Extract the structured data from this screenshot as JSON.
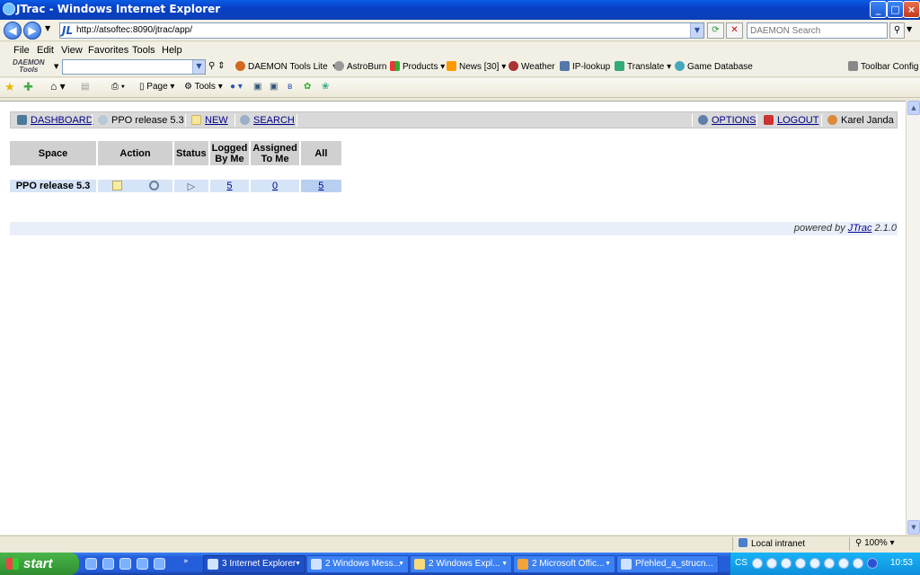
{
  "window": {
    "title": "JTrac - Windows Internet Explorer"
  },
  "address": {
    "url": "http://atsoftec:8090/jtrac/app/",
    "search_placeholder": "DAEMON Search"
  },
  "menu": [
    "File",
    "Edit",
    "View",
    "Favorites",
    "Tools",
    "Help"
  ],
  "daemon_toolbar": {
    "logo_line1": "DAEMON",
    "logo_line2": "Tools",
    "items": [
      "DAEMON Tools Lite",
      "AstroBurn",
      "Products",
      "News [30]",
      "Weather",
      "IP-lookup",
      "Translate",
      "Game Database",
      "Toolbar Config"
    ]
  },
  "command_bar": {
    "page": "Page",
    "tools": "Tools"
  },
  "jtrac": {
    "header": {
      "dashboard": "DASHBOARD",
      "space": "PPO release 5.3",
      "new": "NEW",
      "search": "SEARCH",
      "options": "OPTIONS",
      "logout": "LOGOUT",
      "user": "Karel Janda"
    },
    "table": {
      "headers": {
        "space": "Space",
        "action": "Action",
        "status": "Status",
        "logged_1": "Logged",
        "logged_2": "By Me",
        "assigned_1": "Assigned",
        "assigned_2": "To Me",
        "all": "All"
      },
      "row": {
        "space": "PPO release 5.3",
        "logged": "5",
        "assigned": "0",
        "all": "5"
      }
    },
    "footer": {
      "prefix": "powered by ",
      "link": "JTrac",
      "version": " 2.1.0"
    }
  },
  "status": {
    "zone": "Local intranet",
    "zoom": "100%"
  },
  "taskbar": {
    "start": "start",
    "tasks": [
      "3 Internet Explorer",
      "2 Windows Mess...",
      "2 Windows Expl...",
      "2 Microsoft Offic...",
      "Přehled_a_strucn..."
    ],
    "lang": "CS",
    "clock": "10:53"
  },
  "colors": {
    "table_row": "#d6e4f8",
    "header_bar": "#d9d9d9",
    "link": "#00008b",
    "taskbar": "#245edb",
    "start": "#308d30"
  }
}
